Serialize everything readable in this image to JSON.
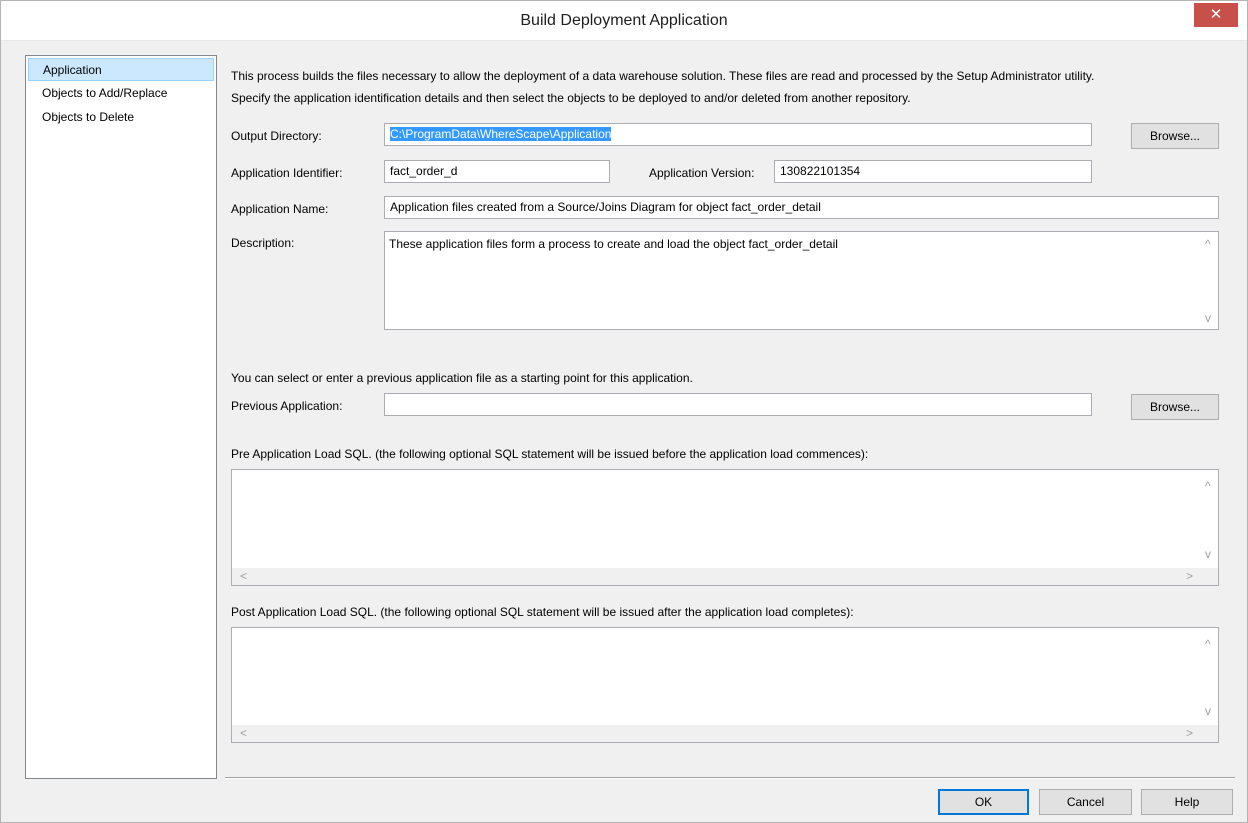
{
  "window": {
    "title": "Build Deployment Application",
    "close_label": "✕"
  },
  "nav": {
    "items": [
      {
        "label": "Application",
        "selected": true
      },
      {
        "label": "Objects to Add/Replace",
        "selected": false
      },
      {
        "label": "Objects to Delete",
        "selected": false
      }
    ]
  },
  "intro": {
    "line1": "This process builds the files necessary to allow the deployment of a data warehouse solution. These files are read and processed by the Setup Administrator utility.",
    "line2": "Specify the application identification details and then select the objects to be deployed to and/or deleted from another repository."
  },
  "form": {
    "output_directory_label": "Output Directory:",
    "output_directory_value": "C:\\ProgramData\\WhereScape\\Application",
    "browse_label": "Browse...",
    "app_identifier_label": "Application Identifier:",
    "app_identifier_value": "fact_order_d",
    "app_version_label": "Application Version:",
    "app_version_value": "130822101354",
    "app_name_label": "Application Name:",
    "app_name_value": "Application files created from a Source/Joins Diagram for object fact_order_detail",
    "description_label": "Description:",
    "description_value": "These application files form a process to create and load the object fact_order_detail"
  },
  "previous": {
    "hint": "You can select or enter a previous application file as a starting point for this application.",
    "label": "Previous Application:",
    "value": "",
    "browse_label": "Browse..."
  },
  "pre_sql": {
    "label": "Pre Application Load SQL. (the following optional SQL statement will be issued before the application load commences):",
    "value": ""
  },
  "post_sql": {
    "label": "Post Application Load SQL. (the following optional SQL statement will be issued after the application load completes):",
    "value": ""
  },
  "footer": {
    "ok_label": "OK",
    "cancel_label": "Cancel",
    "help_label": "Help"
  },
  "icons": {
    "scroll_up": "^",
    "scroll_down": "v",
    "scroll_left": "<",
    "scroll_right": ">"
  }
}
